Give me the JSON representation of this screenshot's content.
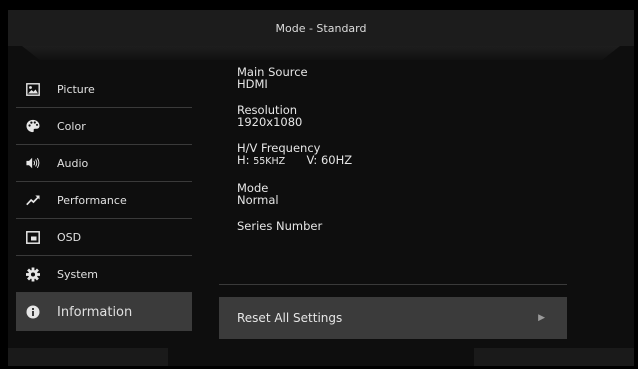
{
  "header": {
    "title": "Mode - Standard"
  },
  "sidebar": {
    "items": [
      {
        "label": "Picture",
        "icon": "picture-icon"
      },
      {
        "label": "Color",
        "icon": "palette-icon"
      },
      {
        "label": "Audio",
        "icon": "speaker-icon"
      },
      {
        "label": "Performance",
        "icon": "trend-arrow-icon"
      },
      {
        "label": "OSD",
        "icon": "osd-window-icon"
      },
      {
        "label": "System",
        "icon": "gear-icon"
      },
      {
        "label": "Information",
        "icon": "info-icon",
        "selected": true
      }
    ]
  },
  "info": {
    "main_source_label": "Main Source",
    "main_source_value": "HDMI",
    "resolution_label": "Resolution",
    "resolution_value": "1920x1080",
    "frequency_label": "H/V Frequency",
    "h_prefix": "H:",
    "h_value": "55KHZ",
    "v_prefix": "V:",
    "v_value": "60HZ",
    "mode_label": "Mode",
    "mode_value": "Normal",
    "series_label": "Series Number",
    "series_value": ""
  },
  "reset": {
    "label": "Reset All Settings",
    "arrow": "▶"
  },
  "colors": {
    "background": "#0e0e0e",
    "panel": "#1c1c1c",
    "selected": "#3b3b3b",
    "text": "#e6e6e6"
  }
}
